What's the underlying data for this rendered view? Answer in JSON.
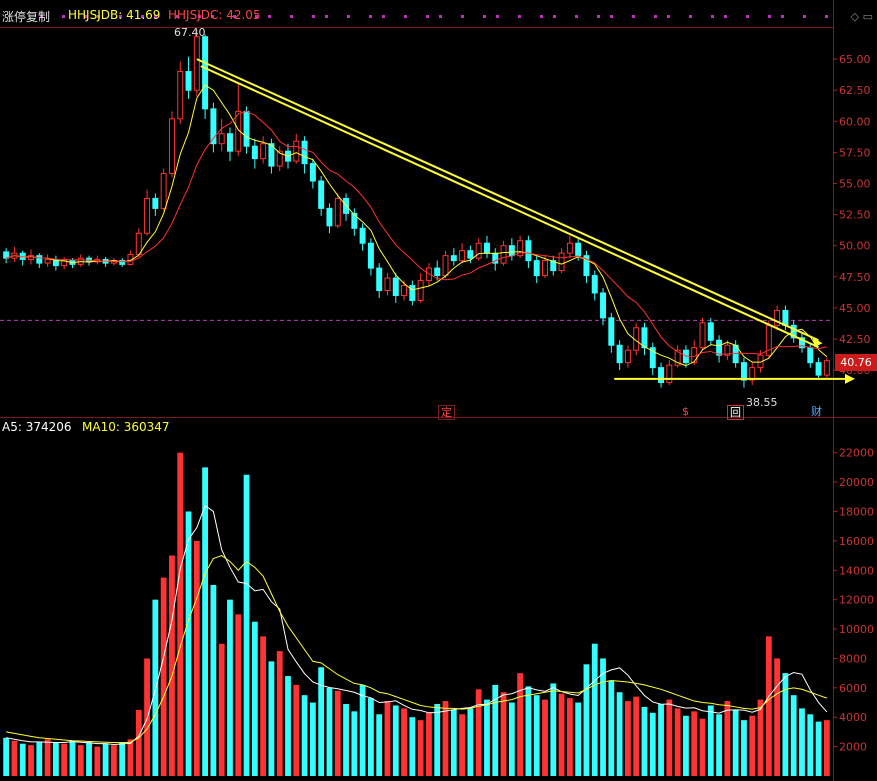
{
  "header": {
    "title": "涨停复制",
    "ind1_label": "HHJSJDB: 41.69",
    "ind2_label": "HHJSJDC: 42.05",
    "vol_label1": "A5: 374206",
    "vol_label2": "MA10: 360347"
  },
  "price_tag": "40.76",
  "annotations": {
    "high_label": "67.40",
    "low_label": "38.55",
    "marker_ding": "定",
    "marker_s": "$",
    "marker_hui": "回",
    "marker_cai": "财"
  },
  "colors": {
    "up": "#ff3333",
    "down": "#33ffff",
    "ma5": "#ffffff",
    "ma10": "#ffff33",
    "ma_red": "#ff3030",
    "trend": "#ffff33"
  },
  "chart_data": [
    {
      "type": "candlestick",
      "title": "",
      "y_ticks": [
        "40.00",
        "42.50",
        "45.00",
        "47.50",
        "50.00",
        "52.50",
        "55.00",
        "57.50",
        "60.00",
        "62.50",
        "65.00"
      ],
      "ylim": [
        38.0,
        67.5
      ],
      "grid": false,
      "high": 67.4,
      "low": 38.55,
      "last": 40.76,
      "dashed_level": 44.0,
      "candles": [
        [
          49.5,
          49.0,
          49.8,
          48.6
        ],
        [
          49.0,
          49.4,
          49.9,
          48.7
        ],
        [
          49.4,
          48.9,
          49.6,
          48.4
        ],
        [
          48.9,
          49.2,
          49.7,
          48.5
        ],
        [
          49.2,
          48.6,
          49.4,
          48.2
        ],
        [
          48.6,
          48.9,
          49.3,
          48.3
        ],
        [
          48.9,
          48.4,
          49.2,
          48.0
        ],
        [
          48.4,
          48.8,
          49.1,
          48.1
        ],
        [
          48.8,
          48.5,
          49.0,
          48.2
        ],
        [
          48.5,
          49.0,
          49.3,
          48.3
        ],
        [
          49.0,
          48.7,
          49.2,
          48.4
        ],
        [
          48.7,
          48.9,
          49.2,
          48.5
        ],
        [
          48.9,
          48.6,
          49.1,
          48.3
        ],
        [
          48.6,
          48.8,
          49.0,
          48.4
        ],
        [
          48.8,
          48.5,
          49.0,
          48.3
        ],
        [
          48.5,
          49.3,
          49.6,
          48.4
        ],
        [
          49.3,
          51.0,
          51.4,
          49.1
        ],
        [
          51.0,
          53.8,
          54.5,
          50.8
        ],
        [
          53.8,
          53.0,
          54.2,
          52.4
        ],
        [
          53.0,
          55.8,
          56.2,
          52.8
        ],
        [
          55.8,
          60.2,
          60.8,
          55.5
        ],
        [
          60.2,
          64.0,
          64.8,
          59.8
        ],
        [
          64.0,
          62.5,
          65.2,
          61.8
        ],
        [
          62.5,
          66.8,
          67.4,
          62.0
        ],
        [
          66.8,
          61.0,
          67.0,
          60.2
        ],
        [
          61.0,
          58.2,
          61.5,
          57.5
        ],
        [
          58.2,
          59.0,
          60.2,
          57.6
        ],
        [
          59.0,
          57.6,
          59.5,
          56.8
        ],
        [
          57.6,
          60.8,
          63.0,
          57.2
        ],
        [
          60.8,
          58.0,
          61.2,
          57.4
        ],
        [
          58.0,
          57.0,
          58.6,
          56.2
        ],
        [
          57.0,
          58.2,
          58.8,
          56.6
        ],
        [
          58.2,
          56.4,
          58.6,
          55.8
        ],
        [
          56.4,
          57.6,
          58.0,
          56.0
        ],
        [
          57.6,
          56.8,
          58.2,
          56.2
        ],
        [
          56.8,
          58.4,
          59.0,
          56.6
        ],
        [
          58.4,
          56.6,
          58.8,
          55.8
        ],
        [
          56.6,
          55.2,
          57.0,
          54.6
        ],
        [
          55.2,
          53.0,
          55.6,
          52.4
        ],
        [
          53.0,
          51.6,
          53.4,
          51.0
        ],
        [
          51.6,
          53.8,
          54.2,
          51.4
        ],
        [
          53.8,
          52.6,
          54.2,
          52.0
        ],
        [
          52.6,
          51.4,
          53.0,
          50.8
        ],
        [
          51.4,
          50.2,
          51.8,
          49.6
        ],
        [
          50.2,
          48.2,
          50.6,
          47.6
        ],
        [
          48.2,
          46.4,
          48.6,
          45.8
        ],
        [
          46.4,
          47.4,
          47.8,
          46.0
        ],
        [
          47.4,
          46.0,
          47.8,
          45.4
        ],
        [
          46.0,
          46.8,
          47.2,
          45.6
        ],
        [
          46.8,
          45.6,
          47.2,
          45.2
        ],
        [
          45.6,
          47.2,
          47.8,
          45.4
        ],
        [
          47.2,
          48.2,
          48.6,
          46.8
        ],
        [
          48.2,
          47.6,
          48.8,
          47.2
        ],
        [
          47.6,
          49.2,
          49.6,
          47.4
        ],
        [
          49.2,
          48.8,
          49.8,
          48.4
        ],
        [
          48.8,
          49.6,
          50.2,
          48.6
        ],
        [
          49.6,
          49.0,
          50.0,
          48.6
        ],
        [
          49.0,
          50.2,
          50.6,
          48.8
        ],
        [
          50.2,
          49.4,
          50.8,
          49.0
        ],
        [
          49.4,
          48.6,
          49.8,
          48.0
        ],
        [
          48.6,
          50.0,
          50.4,
          48.4
        ],
        [
          50.0,
          49.2,
          50.6,
          48.8
        ],
        [
          49.2,
          50.4,
          50.8,
          49.0
        ],
        [
          50.4,
          48.8,
          50.8,
          48.2
        ],
        [
          48.8,
          47.6,
          49.2,
          47.0
        ],
        [
          47.6,
          48.8,
          49.2,
          47.4
        ],
        [
          48.8,
          48.0,
          49.2,
          47.6
        ],
        [
          48.0,
          49.4,
          49.8,
          47.8
        ],
        [
          49.4,
          50.2,
          50.8,
          49.0
        ],
        [
          50.2,
          49.2,
          50.6,
          48.8
        ],
        [
          49.2,
          47.6,
          49.6,
          47.0
        ],
        [
          47.6,
          46.2,
          48.0,
          45.6
        ],
        [
          46.2,
          44.2,
          46.6,
          43.6
        ],
        [
          44.2,
          42.0,
          44.6,
          41.4
        ],
        [
          42.0,
          40.6,
          42.4,
          40.0
        ],
        [
          40.6,
          41.6,
          42.0,
          40.2
        ],
        [
          41.6,
          43.4,
          43.8,
          41.2
        ],
        [
          43.4,
          41.8,
          43.8,
          41.2
        ],
        [
          41.8,
          40.2,
          42.2,
          39.6
        ],
        [
          40.2,
          39.0,
          40.6,
          38.6
        ],
        [
          39.0,
          40.4,
          40.8,
          38.8
        ],
        [
          40.4,
          41.6,
          42.0,
          40.2
        ],
        [
          41.6,
          40.6,
          42.0,
          40.2
        ],
        [
          40.6,
          41.8,
          42.4,
          40.4
        ],
        [
          41.8,
          43.8,
          44.2,
          41.6
        ],
        [
          43.8,
          42.4,
          44.2,
          42.0
        ],
        [
          42.4,
          41.2,
          42.8,
          40.6
        ],
        [
          41.2,
          42.0,
          42.4,
          40.8
        ],
        [
          42.0,
          40.6,
          42.4,
          40.2
        ],
        [
          40.6,
          39.2,
          41.0,
          38.6
        ],
        [
          39.2,
          40.2,
          40.6,
          38.8
        ],
        [
          40.2,
          41.2,
          41.6,
          39.8
        ],
        [
          41.2,
          43.6,
          44.0,
          41.0
        ],
        [
          43.6,
          44.8,
          45.2,
          43.2
        ],
        [
          44.8,
          43.6,
          45.2,
          43.2
        ],
        [
          43.6,
          42.6,
          44.0,
          42.2
        ],
        [
          42.6,
          41.8,
          43.0,
          41.4
        ],
        [
          41.8,
          40.6,
          42.2,
          40.2
        ],
        [
          40.6,
          39.6,
          41.0,
          39.2
        ],
        [
          39.6,
          40.76,
          41.0,
          39.4
        ]
      ],
      "trendlines": [
        {
          "from": [
            23,
            65.0
          ],
          "to": [
            98,
            42.4
          ],
          "double": true
        },
        {
          "from": [
            83,
            39.3
          ],
          "to": [
            100,
            39.3
          ],
          "arrow": true
        }
      ]
    },
    {
      "type": "bar",
      "title": "",
      "y_ticks": [
        "2000",
        "4000",
        "6000",
        "8000",
        "10000",
        "12000",
        "14000",
        "16000",
        "18000",
        "20000",
        "22000"
      ],
      "ylim": [
        0,
        23000
      ],
      "grid": false,
      "series": [
        {
          "name": "A5",
          "values": [
            2600,
            2400,
            2200,
            2100,
            2300,
            2500,
            2300,
            2200,
            2400,
            2100,
            2300,
            2000,
            2200,
            2100,
            2300,
            2500,
            4500,
            8000,
            12000,
            13500,
            15000,
            22000,
            18000,
            16000,
            21000,
            13000,
            9000,
            12000,
            11000,
            20500,
            10500,
            9500,
            7800,
            8500,
            6800,
            6200,
            5500,
            5000,
            7400,
            6000,
            5800,
            4900,
            4400,
            6200,
            5300,
            4200,
            5100,
            4800,
            4600,
            4000,
            3800,
            4300,
            4900,
            5100,
            4500,
            4200,
            4600,
            5900,
            5200,
            6200,
            5700,
            5000,
            7000,
            6100,
            5500,
            5200,
            6300,
            5600,
            5300,
            5000,
            7600,
            9000,
            8000,
            6500,
            5700,
            5100,
            5400,
            4700,
            4300,
            4900,
            5200,
            4600,
            4100,
            4400,
            3900,
            4800,
            4200,
            5100,
            4500,
            3800,
            4100,
            5200,
            9500,
            8000,
            7000,
            5500,
            4600,
            4200,
            3700,
            3800
          ]
        },
        {
          "name": "MA10",
          "values": [
            3000,
            2900,
            2800,
            2700,
            2600,
            2550,
            2500,
            2450,
            2400,
            2380,
            2350,
            2320,
            2300,
            2280,
            2270,
            2300,
            2600,
            3200,
            4200,
            5400,
            6800,
            8800,
            10600,
            12100,
            13800,
            14800,
            15000,
            14600,
            14000,
            14600,
            14200,
            13600,
            12400,
            11200,
            10200,
            9400,
            8600,
            7800,
            7700,
            7300,
            6900,
            6600,
            6300,
            6200,
            6000,
            5700,
            5600,
            5400,
            5200,
            5000,
            4800,
            4700,
            4650,
            4600,
            4600,
            4550,
            4600,
            4750,
            4850,
            5000,
            5100,
            5200,
            5400,
            5500,
            5600,
            5700,
            5800,
            5750,
            5700,
            5650,
            5900,
            6200,
            6400,
            6500,
            6450,
            6400,
            6300,
            6200,
            6050,
            5900,
            5700,
            5500,
            5300,
            5100,
            5000,
            4950,
            4850,
            4800,
            4700,
            4600,
            4550,
            4650,
            5200,
            5600,
            5900,
            6000,
            5900,
            5700,
            5500,
            5300
          ]
        }
      ]
    }
  ]
}
